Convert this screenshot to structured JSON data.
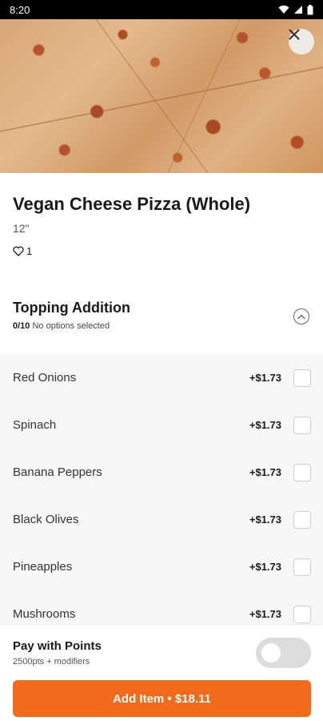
{
  "status_bar": {
    "time": "8:20",
    "icons": [
      "wifi-icon",
      "signal-icon",
      "battery-icon"
    ]
  },
  "hero": {
    "image_alt_icon": "pizza-photo"
  },
  "item": {
    "title": "Vegan Cheese Pizza (Whole)",
    "size": "12\"",
    "likes": "1"
  },
  "section": {
    "title": "Topping Addition",
    "count": "0/10",
    "status": "No options selected"
  },
  "options": [
    {
      "label": "Red Onions",
      "price": "+$1.73"
    },
    {
      "label": "Spinach",
      "price": "+$1.73"
    },
    {
      "label": "Banana Peppers",
      "price": "+$1.73"
    },
    {
      "label": "Black Olives",
      "price": "+$1.73"
    },
    {
      "label": "Pineapples",
      "price": "+$1.73"
    },
    {
      "label": "Mushrooms",
      "price": "+$1.73"
    }
  ],
  "footer": {
    "points_title": "Pay with Points",
    "points_sub": "2500pts + modifiers",
    "points_toggle_on": false,
    "add_button_label": "Add Item • $18.11"
  },
  "colors": {
    "accent": "#f26a1b",
    "list_bg": "#f7f7f8",
    "toggle_off": "#dcdcdc"
  }
}
